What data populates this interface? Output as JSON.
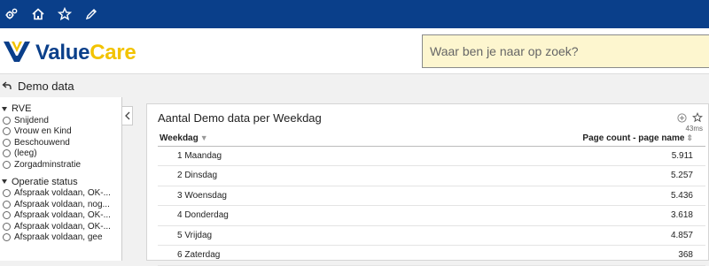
{
  "topbar": {
    "icons": [
      "gears-icon",
      "home-icon",
      "star-icon",
      "pencil-icon"
    ]
  },
  "brand": {
    "part1": "Value",
    "part2": "Care",
    "primary": "#0a3f8a",
    "accent": "#f2c300"
  },
  "search": {
    "placeholder": "Waar ben je naar op zoek?"
  },
  "breadcrumb": {
    "title": "Demo data"
  },
  "sidebar": {
    "groups": [
      {
        "label": "RVE",
        "options": [
          "Snijdend",
          "Vrouw en Kind",
          "Beschouwend",
          "(leeg)",
          "Zorgadminstratie"
        ]
      },
      {
        "label": "Operatie status",
        "options": [
          "Afspraak voldaan, OK-...",
          "Afspraak voldaan, nog...",
          "Afspraak voldaan, OK-...",
          "Afspraak voldaan, OK-...",
          "Afspraak voldaan, gee"
        ]
      }
    ]
  },
  "panel": {
    "title": "Aantal Demo data per Weekdag",
    "timing": "43ms",
    "columns": {
      "day": "Weekdag",
      "count": "Page count - page name"
    },
    "rows": [
      {
        "day": "1 Maandag",
        "count": "5.911"
      },
      {
        "day": "2 Dinsdag",
        "count": "5.257"
      },
      {
        "day": "3 Woensdag",
        "count": "5.436"
      },
      {
        "day": "4 Donderdag",
        "count": "3.618"
      },
      {
        "day": "5 Vrijdag",
        "count": "4.857"
      },
      {
        "day": "6 Zaterdag",
        "count": "368"
      }
    ]
  }
}
